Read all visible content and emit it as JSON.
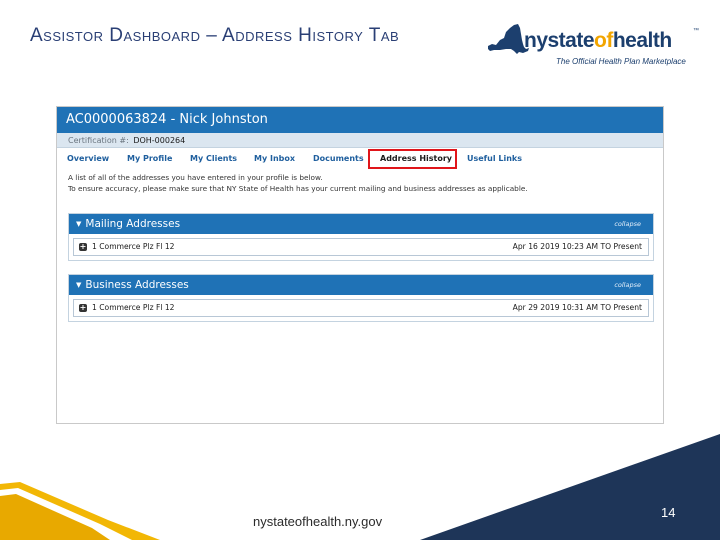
{
  "slide": {
    "title": "Assistor Dashboard – Address History Tab",
    "footer_url": "nystateofhealth.ny.gov",
    "page_number": "14",
    "colors": {
      "title": "#2a3f75",
      "footer_navy": "#1e3558",
      "footer_gold": "#f2b705"
    }
  },
  "logo": {
    "part1": "nystate",
    "part2": "of",
    "part3": "health",
    "trademark": "™",
    "tagline": "The Official Health Plan Marketplace",
    "colors": {
      "navy": "#1c3f6e",
      "orange": "#f2a500"
    }
  },
  "screenshot": {
    "header": "AC0000063824 - Nick   Johnston",
    "cert_label": "Certification #:",
    "cert_value": "DOH-000264",
    "nav": [
      {
        "label": "Overview"
      },
      {
        "label": "My Profile"
      },
      {
        "label": "My Clients"
      },
      {
        "label": "My Inbox"
      },
      {
        "label": "Documents"
      },
      {
        "label": "Address History"
      },
      {
        "label": "Useful Links"
      }
    ],
    "active_tab": "Address History",
    "description": [
      "A list of all of the addresses you have entered in your profile is below.",
      "To ensure accuracy, please make sure that NY State of Health has your current mailing and business addresses as applicable."
    ],
    "sections": [
      {
        "title": "Mailing Addresses",
        "collapse_label": "collapse",
        "rows": [
          {
            "address": "1 Commerce Plz Fl 12",
            "date_range": "Apr 16 2019 10:23 AM TO Present"
          }
        ]
      },
      {
        "title": "Business Addresses",
        "collapse_label": "collapse",
        "rows": [
          {
            "address": "1 Commerce Plz Fl 12",
            "date_range": "Apr 29 2019 10:31 AM TO Present"
          }
        ]
      }
    ],
    "colors": {
      "header_blue": "#1f72b6",
      "highlight_red": "#e0151a"
    }
  }
}
